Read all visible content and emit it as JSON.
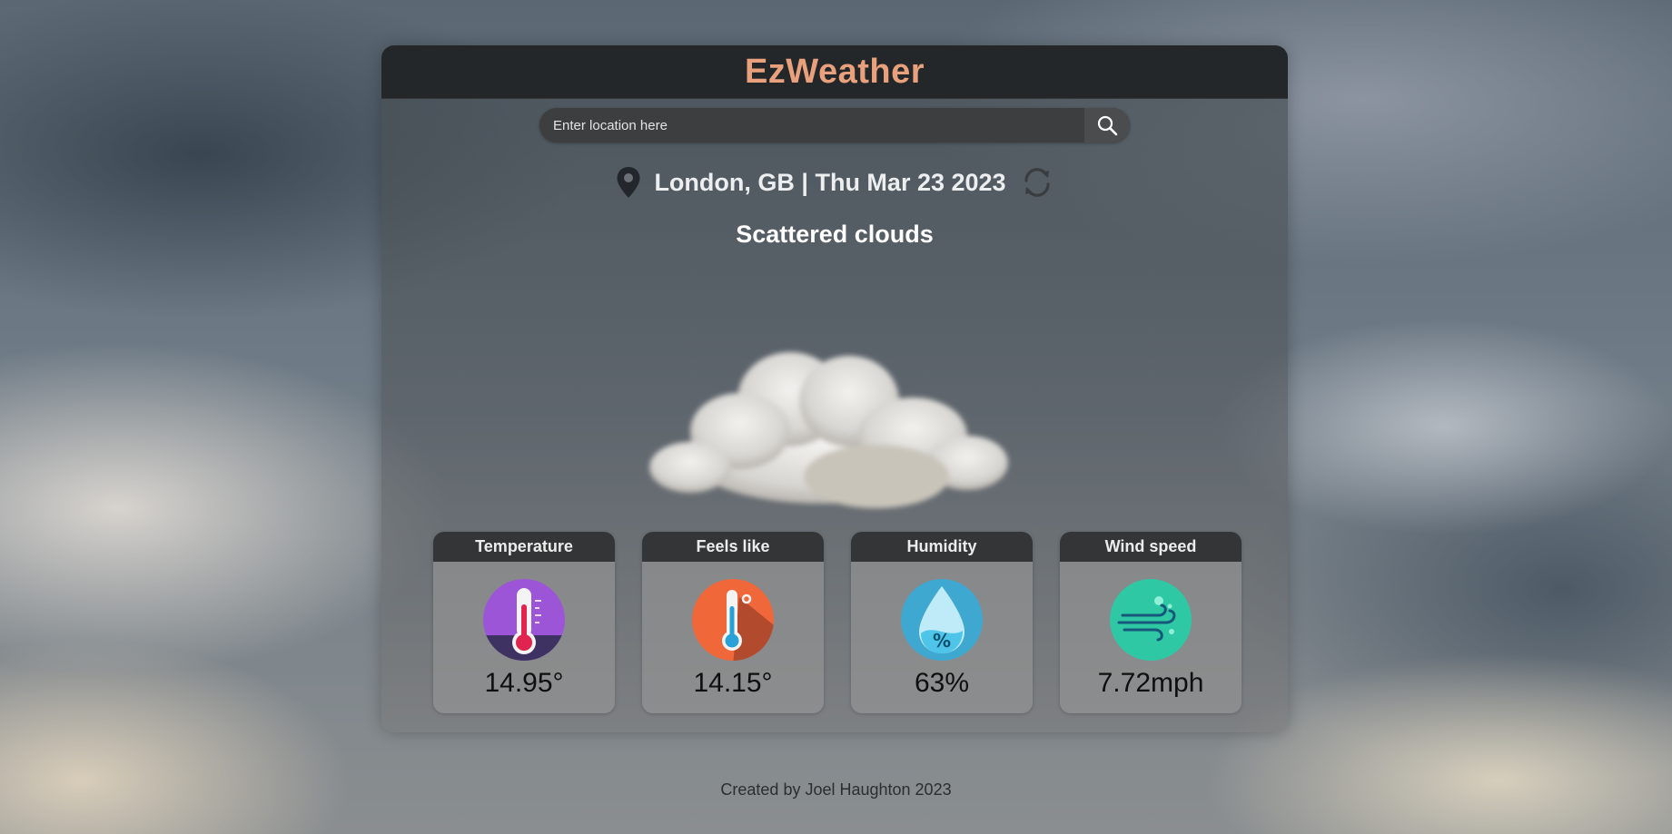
{
  "header": {
    "title": "EzWeather"
  },
  "search": {
    "placeholder": "Enter location here",
    "value": ""
  },
  "location": {
    "text": "London, GB | Thu Mar 23 2023"
  },
  "weather": {
    "description": "Scattered clouds",
    "icon": "cloud-icon"
  },
  "cards": [
    {
      "title": "Temperature",
      "value": "14.95°",
      "icon": "thermometer-icon"
    },
    {
      "title": "Feels like",
      "value": "14.15°",
      "icon": "feels-like-thermometer-icon"
    },
    {
      "title": "Humidity",
      "value": "63%",
      "icon": "humidity-drop-icon"
    },
    {
      "title": "Wind speed",
      "value": "7.72mph",
      "icon": "wind-icon"
    }
  ],
  "footer": {
    "text": "Created by Joel Haughton 2023"
  },
  "colors": {
    "title_accent": "#e8a17c",
    "header_bar": "#23272a",
    "card_title_bar": "#333536"
  }
}
